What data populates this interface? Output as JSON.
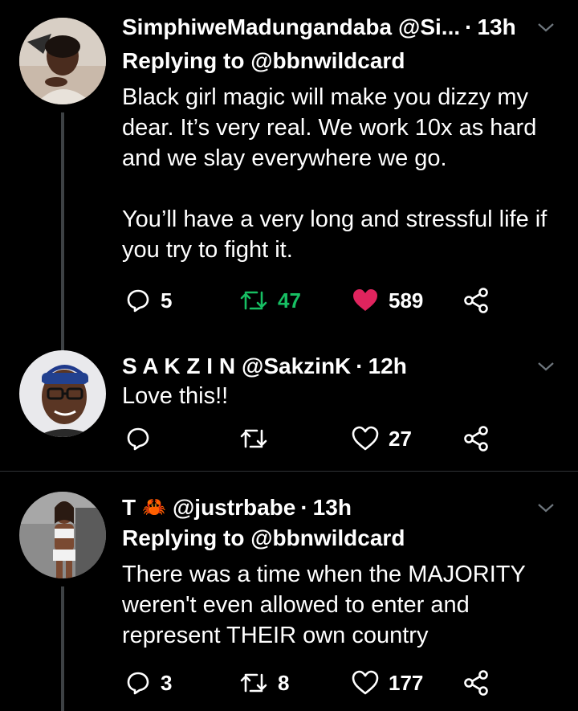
{
  "colors": {
    "background": "#000000",
    "like": "#e0245e",
    "retweet": "#17bf63",
    "line": "#3d4144"
  },
  "tweets": [
    {
      "name": "SimphiweMadungandaba",
      "handle": "@Si...",
      "dot": "·",
      "time": "13h",
      "replying_to": "Replying to @bbnwildcard",
      "text": "Black girl magic will make you dizzy my dear. It’s very real. We work 10x as hard and we slay everywhere we go.\n\nYou’ll have a very long and stressful life if you try to fight it.",
      "replies": "5",
      "retweets": "47",
      "likes": "589",
      "liked": true,
      "retweeted": true,
      "avatar_icon": "profile-photo-woman"
    },
    {
      "name": "S A K Z I N",
      "handle": "@SakzinK",
      "dot": "·",
      "time": "12h",
      "text": "Love this!!",
      "replies": "",
      "retweets": "",
      "likes": "27",
      "avatar_icon": "profile-photo-man-glasses"
    },
    {
      "name": "T",
      "emoji": "🦀",
      "handle": "@justrbabe",
      "dot": "·",
      "time": "13h",
      "replying_to": "Replying to @bbnwildcard",
      "text": "There was a time when the MAJORITY weren't even allowed to enter and represent THEIR own country",
      "replies": "3",
      "retweets": "8",
      "likes": "177",
      "avatar_icon": "profile-photo-woman-white-outfit"
    }
  ]
}
